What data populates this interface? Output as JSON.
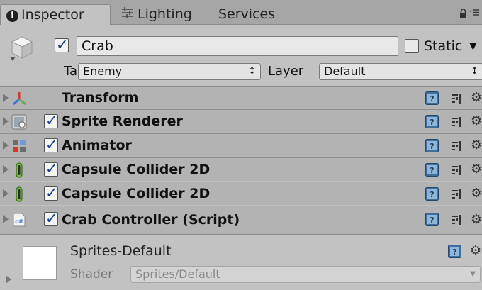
{
  "tabs": [
    {
      "label": "Inspector",
      "icon": "info-icon",
      "active": true
    },
    {
      "label": "Lighting",
      "icon": "lighting-icon",
      "active": false
    },
    {
      "label": "Services",
      "icon": "",
      "active": false
    }
  ],
  "header": {
    "name": "Crab",
    "active": true,
    "static_label": "Static",
    "static_checked": false,
    "tag_label": "Tag",
    "tag_value": "Enemy",
    "layer_label": "Layer",
    "layer_value": "Default",
    "select_arrow": "↕"
  },
  "components": [
    {
      "title": "Transform",
      "icon": "transform-icon",
      "has_checkbox": false
    },
    {
      "title": "Sprite Renderer",
      "icon": "sprite-renderer-icon",
      "has_checkbox": true,
      "checked": true
    },
    {
      "title": "Animator",
      "icon": "animator-icon",
      "has_checkbox": true,
      "checked": true
    },
    {
      "title": "Capsule Collider 2D",
      "icon": "capsule-collider-icon",
      "has_checkbox": true,
      "checked": true
    },
    {
      "title": "Capsule Collider 2D",
      "icon": "capsule-collider-icon",
      "has_checkbox": true,
      "checked": true
    },
    {
      "title": "Crab Controller (Script)",
      "icon": "csharp-script-icon",
      "has_checkbox": true,
      "checked": true
    }
  ],
  "material": {
    "name": "Sprites-Default",
    "shader_label": "Shader",
    "shader_value": "Sprites/Default"
  },
  "colors": {
    "check": "#1a3f8c",
    "help": "#3d6e9e",
    "transform_red": "#d43a2a",
    "transform_green": "#5fb04a",
    "transform_blue": "#3f74d6",
    "collider_green": "#79c043"
  }
}
